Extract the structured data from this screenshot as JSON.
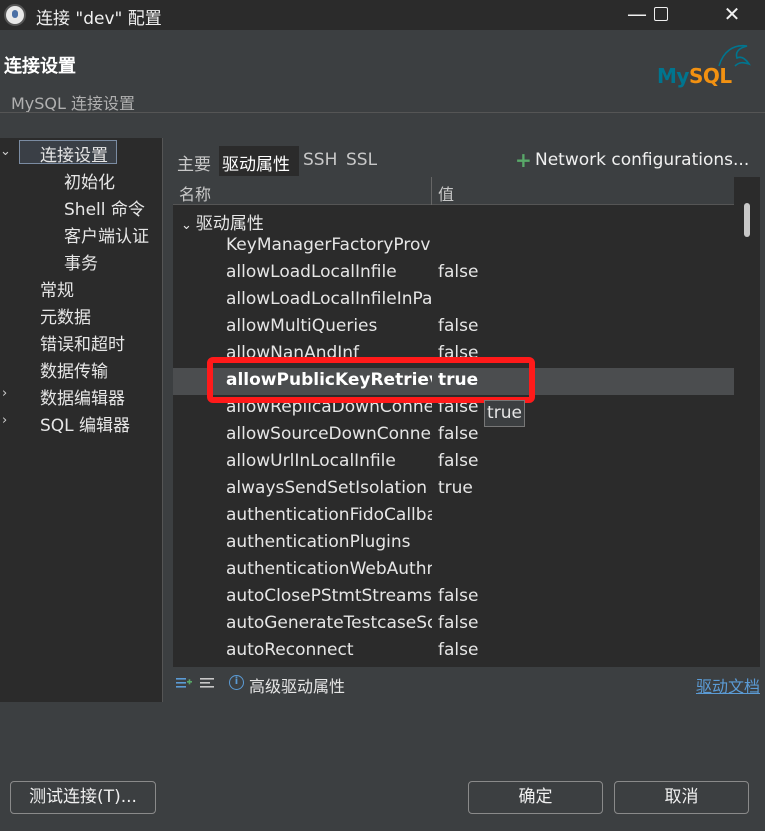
{
  "window": {
    "title": "连接 \"dev\" 配置",
    "app_icon": "dbeaver-icon",
    "minimize_glyph": "—",
    "close_glyph": "✕"
  },
  "header": {
    "title": "连接设置",
    "subtitle": "MySQL 连接设置",
    "logo_text_my": "My",
    "logo_text_sql": "SQL",
    "logo_colors": {
      "my": "#00758f",
      "sql": "#f29111"
    }
  },
  "sidebar": {
    "items": [
      {
        "label": "连接设置",
        "expanded": true,
        "selected": true
      },
      {
        "label": "初始化"
      },
      {
        "label": "Shell 命令"
      },
      {
        "label": "客户端认证"
      },
      {
        "label": "事务"
      },
      {
        "label": "常规"
      },
      {
        "label": "元数据"
      },
      {
        "label": "错误和超时"
      },
      {
        "label": "数据传输"
      },
      {
        "label": "数据编辑器",
        "expandable": true
      },
      {
        "label": "SQL 编辑器",
        "expandable": true
      }
    ]
  },
  "tabs": {
    "items": [
      "主要",
      "驱动属性",
      "SSH",
      "SSL"
    ],
    "active": "驱动属性",
    "network_plus": "+",
    "network_label": "Network configurations..."
  },
  "table": {
    "columns": [
      "名称",
      "值"
    ],
    "group_label": "驱动属性",
    "rows": [
      {
        "name": "KeyManagerFactoryProvider",
        "value": ""
      },
      {
        "name": "allowLoadLocalInfile",
        "value": "false"
      },
      {
        "name": "allowLoadLocalInfileInPath",
        "value": ""
      },
      {
        "name": "allowMultiQueries",
        "value": "false"
      },
      {
        "name": "allowNanAndInf",
        "value": "false"
      },
      {
        "name": "allowPublicKeyRetrieval",
        "value": "true",
        "selected": true
      },
      {
        "name": "allowReplicaDownConnections",
        "value": "false"
      },
      {
        "name": "allowSourceDownConnections",
        "value": "false"
      },
      {
        "name": "allowUrlInLocalInfile",
        "value": "false"
      },
      {
        "name": "alwaysSendSetIsolation",
        "value": "true"
      },
      {
        "name": "authenticationFidoCallbackHandler",
        "value": ""
      },
      {
        "name": "authenticationPlugins",
        "value": ""
      },
      {
        "name": "authenticationWebAuthnCallbackHandler",
        "value": ""
      },
      {
        "name": "autoClosePStmtStreams",
        "value": "false"
      },
      {
        "name": "autoGenerateTestcaseScript",
        "value": "false"
      },
      {
        "name": "autoReconnect",
        "value": "false"
      }
    ],
    "tooltip": "true",
    "highlight_color": "#ff1a1a"
  },
  "table_footer": {
    "info_icon_glyph": "i",
    "label": "高级驱动属性",
    "link": "驱动文档"
  },
  "buttons": {
    "test": "测试连接(T)...",
    "ok": "确定",
    "cancel": "取消"
  }
}
